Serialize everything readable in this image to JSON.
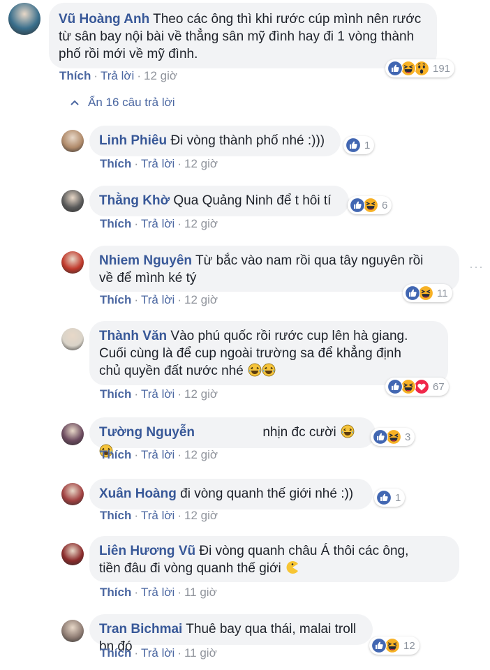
{
  "labels": {
    "like": "Thích",
    "reply": "Trả lời",
    "dot": "·",
    "more": "···"
  },
  "hidden_replies": {
    "chevron": "^",
    "text": "Ẩn 16 câu trả lời"
  },
  "colors": {
    "author": "#385898",
    "bubble_bg": "#f2f3f5",
    "like_blue": "#4267b2",
    "haha_yellow": "#f7b125",
    "love_red": "#f0284a",
    "muted": "#90949c"
  },
  "comments": [
    {
      "author": "Vũ Hoàng Anh",
      "lines": [
        "Theo các ông thì khi rước cúp mình nên rước",
        "từ sân bay nội bài về thẳng sân mỹ đình hay đi 1 vòng thành",
        "phố rồi mới về mỹ đình."
      ],
      "time": "12 giờ",
      "reactions": [
        "like-icon",
        "haha-icon",
        "wow-icon"
      ],
      "count": "191",
      "avatar_color": "#3a6f8c"
    },
    {
      "author": "Linh Phiêu",
      "lines": [
        "Đi vòng thành phố nhé :)))"
      ],
      "time": "12 giờ",
      "reactions": [
        "like-icon"
      ],
      "count": "1",
      "avatar_color": "#b08a6a"
    },
    {
      "author": "Thằng Khờ",
      "lines": [
        "Qua Quảng Ninh để t hôi tí"
      ],
      "time": "12 giờ",
      "reactions": [
        "like-icon",
        "haha-icon"
      ],
      "count": "6",
      "avatar_color": "#5a5a5a"
    },
    {
      "author": "Nhiem Nguyên",
      "lines": [
        "Từ bắc vào nam rồi qua tây nguyên rồi",
        "về để mình ké tý"
      ],
      "time": "12 giờ",
      "reactions": [
        "like-icon",
        "haha-icon"
      ],
      "count": "11",
      "avatar_color": "#c0392b"
    },
    {
      "author": "Thành Văn",
      "lines": [
        "Vào phú quốc rồi rước cup lên hà giang.",
        "Cuối cùng là để cup ngoài trường sa để khẳng định",
        "chủ quyền đất nước nhé"
      ],
      "time": "12 giờ",
      "reactions": [
        "like-icon",
        "haha-icon",
        "love-icon"
      ],
      "count": "67",
      "avatar_color": "#d9d3c8"
    },
    {
      "author": "Tường Nguyễn",
      "lines": [
        "nhịn đc cười"
      ],
      "time": "12 giờ",
      "reactions": [
        "like-icon",
        "haha-icon"
      ],
      "count": "3",
      "avatar_color": "#6b4a5e"
    },
    {
      "author": "Xuân Hoàng",
      "lines": [
        "đi vòng quanh thế giới nhé :))"
      ],
      "time": "12 giờ",
      "reactions": [
        "like-icon"
      ],
      "count": "1",
      "avatar_color": "#a04040"
    },
    {
      "author": "Liên Hương Vũ",
      "lines": [
        "Đi vòng quanh châu Á thôi các ông,",
        "tiền đâu đi vòng quanh thế giới"
      ],
      "time": "11 giờ",
      "reactions": [],
      "count": "",
      "avatar_color": "#8a2b2b"
    },
    {
      "author": "Tran Bichmai",
      "lines": [
        "Thuê bay qua thái, malai troll bn đó"
      ],
      "time": "11 giờ",
      "reactions": [
        "like-icon",
        "haha-icon"
      ],
      "count": "12",
      "avatar_color": "#8f7d74"
    }
  ]
}
